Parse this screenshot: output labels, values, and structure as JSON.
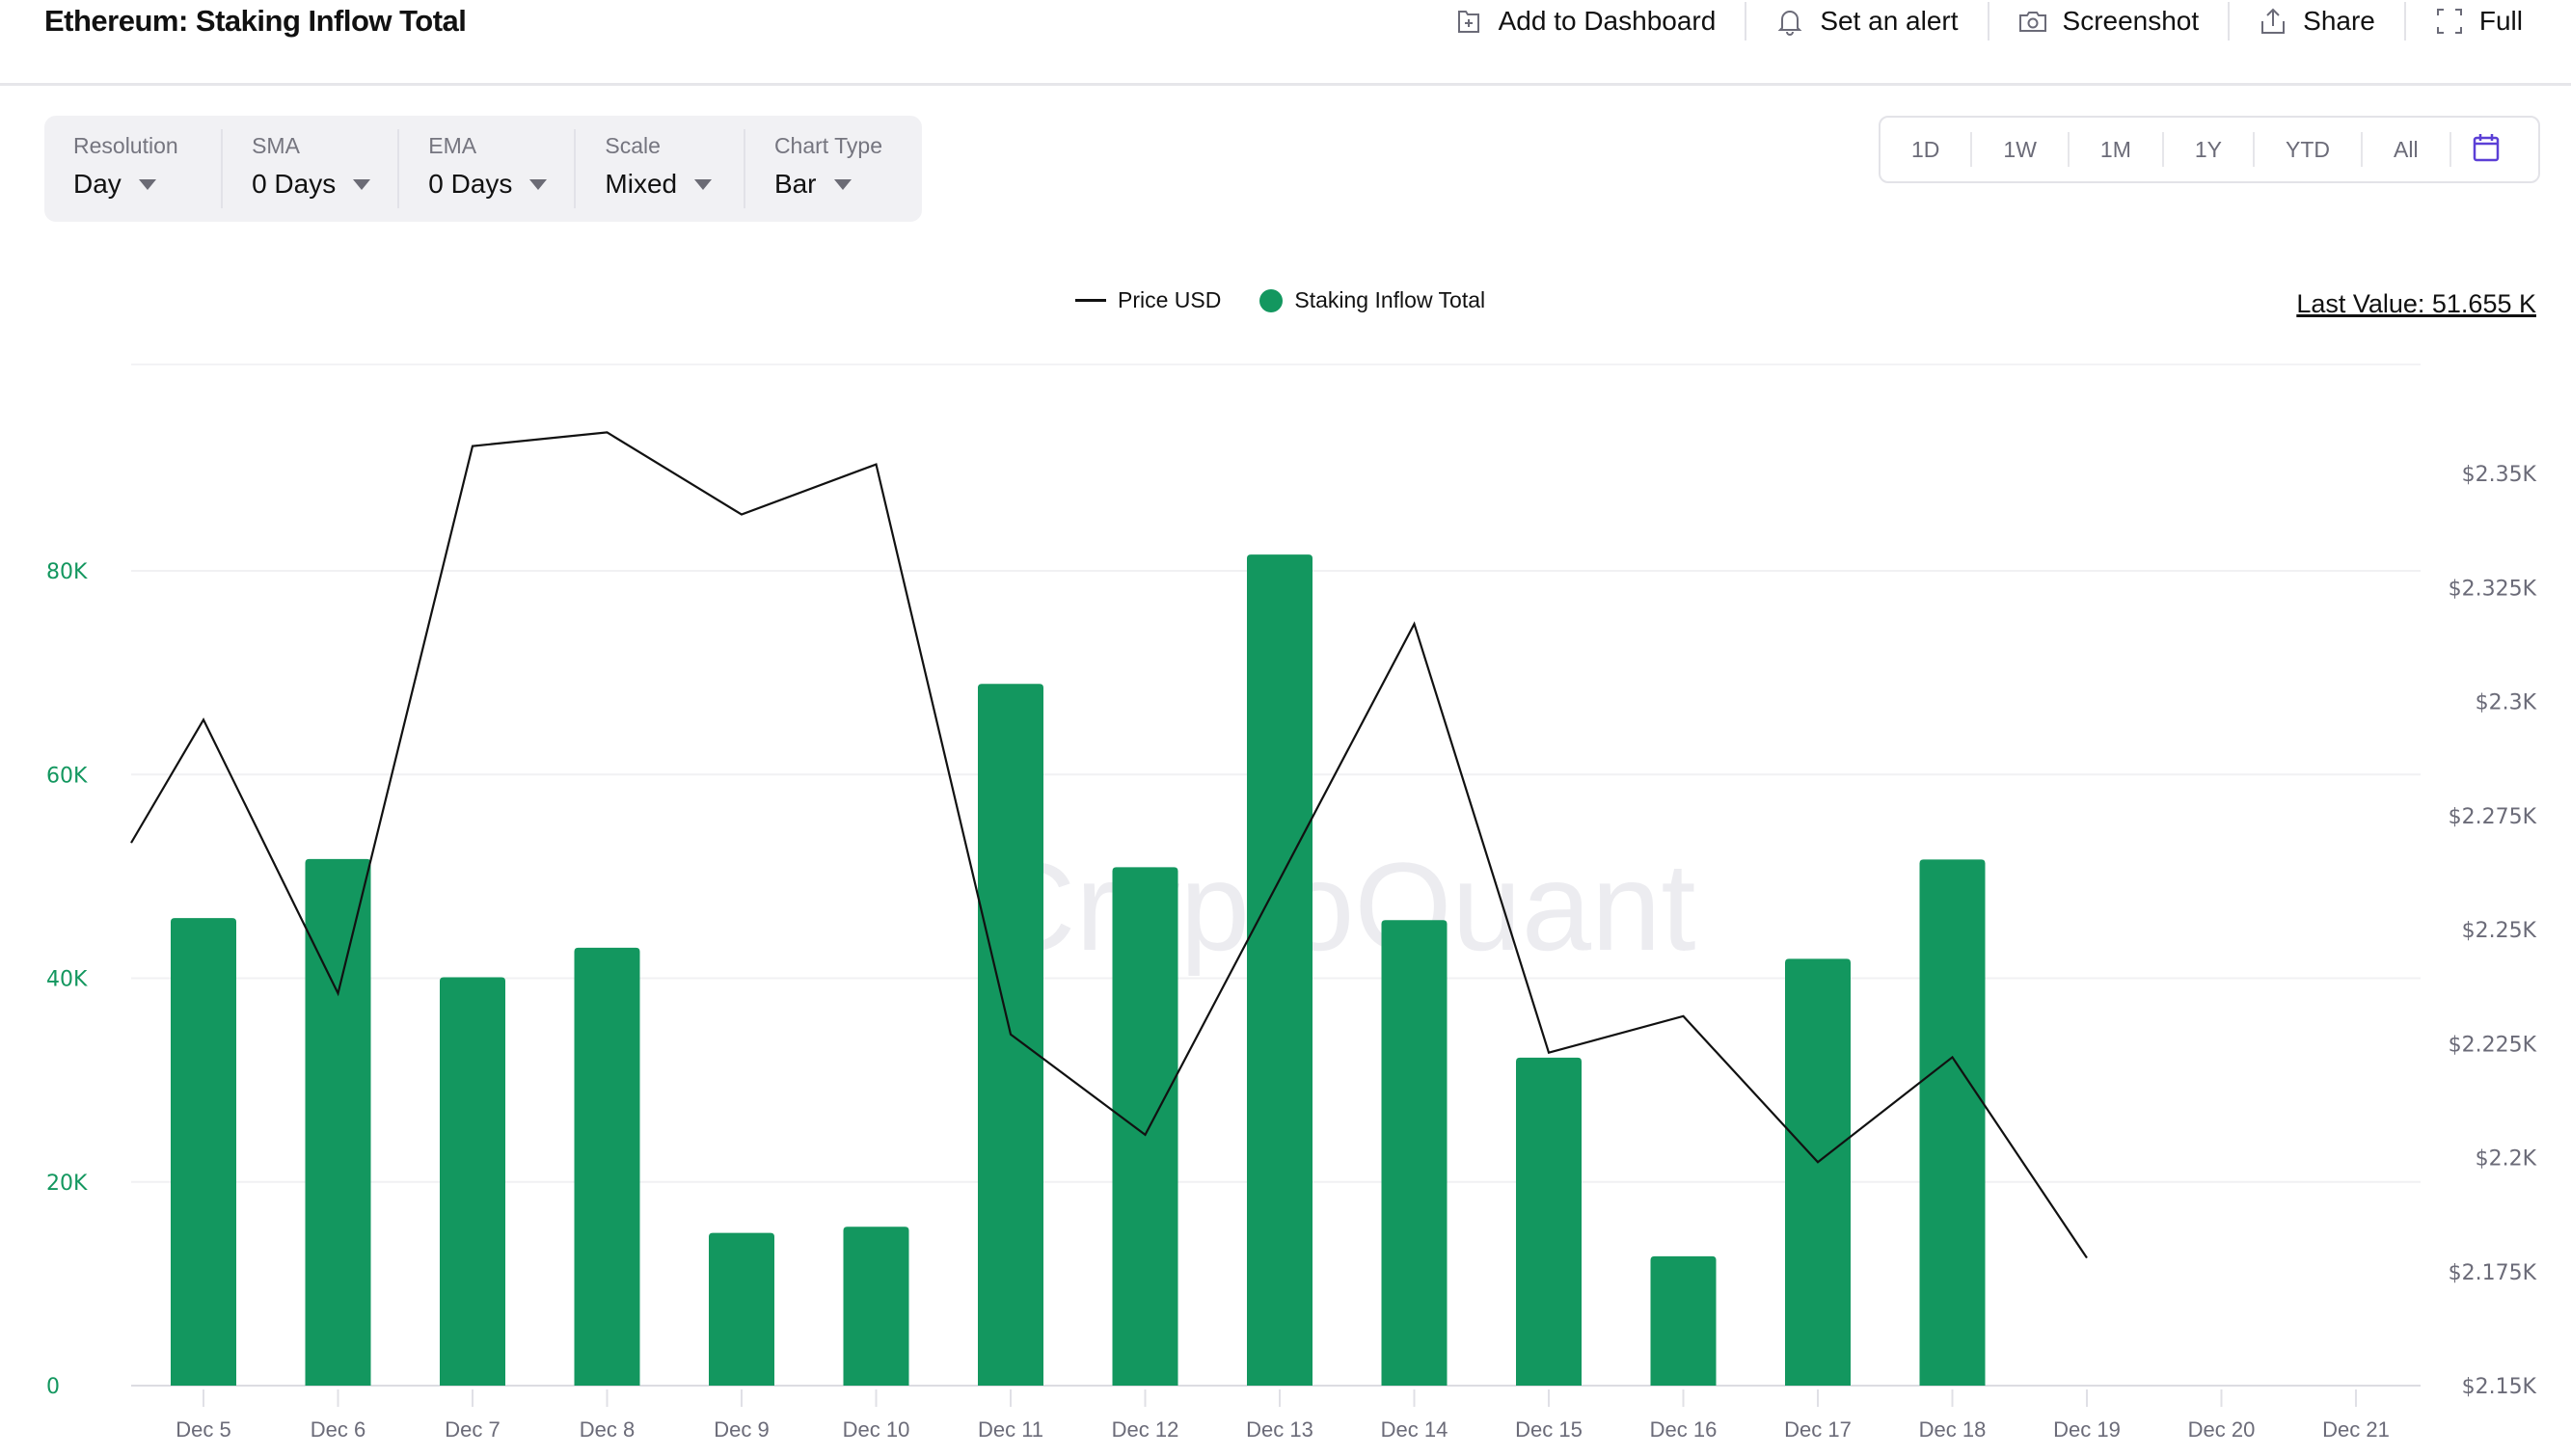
{
  "header": {
    "title": "Ethereum: Staking Inflow Total",
    "actions": [
      {
        "label": "Add to Dashboard",
        "icon": "add-to-dashboard-icon"
      },
      {
        "label": "Set an alert",
        "icon": "bell-icon"
      },
      {
        "label": "Screenshot",
        "icon": "camera-icon"
      },
      {
        "label": "Share",
        "icon": "share-icon"
      },
      {
        "label": "Full",
        "icon": "fullscreen-icon"
      }
    ]
  },
  "controls": [
    {
      "label": "Resolution",
      "value": "Day"
    },
    {
      "label": "SMA",
      "value": "0 Days"
    },
    {
      "label": "EMA",
      "value": "0 Days"
    },
    {
      "label": "Scale",
      "value": "Mixed"
    },
    {
      "label": "Chart Type",
      "value": "Bar"
    }
  ],
  "ranges": [
    "1D",
    "1W",
    "1M",
    "1Y",
    "YTD",
    "All"
  ],
  "last_value": "Last Value: 51.655 K",
  "colors": {
    "bar": "#13975f",
    "line": "#111111",
    "accent": "#5b3fd6"
  },
  "chart_data": {
    "type": "bar",
    "title": "Ethereum: Staking Inflow Total",
    "categories": [
      "Dec 5",
      "Dec 6",
      "Dec 7",
      "Dec 8",
      "Dec 9",
      "Dec 10",
      "Dec 11",
      "Dec 12",
      "Dec 13",
      "Dec 14",
      "Dec 15",
      "Dec 16",
      "Dec 17",
      "Dec 18",
      "Dec 19",
      "Dec 20",
      "Dec 21"
    ],
    "legend": [
      "Price USD",
      "Staking Inflow Total"
    ],
    "legend_position": "top-center",
    "series": [
      {
        "name": "Staking Inflow Total",
        "type": "bar",
        "axis": "left",
        "values": [
          45900,
          51700,
          40100,
          43000,
          15000,
          15600,
          68900,
          50900,
          81600,
          45700,
          32200,
          12700,
          41900,
          51655,
          null,
          null,
          null
        ]
      },
      {
        "name": "Price USD",
        "type": "line",
        "axis": "right",
        "start_value": 2269,
        "values": [
          2296,
          2236,
          2356,
          2359,
          2341,
          2352,
          2227,
          2205,
          2261,
          2317,
          2223,
          2231,
          2199,
          2222,
          2178,
          null,
          null
        ]
      }
    ],
    "left_axis": {
      "ticks": [
        "0",
        "20K",
        "40K",
        "60K",
        "80K"
      ],
      "tick_values": [
        0,
        20000,
        40000,
        60000,
        80000
      ],
      "range": [
        0,
        80000
      ]
    },
    "right_axis": {
      "ticks": [
        "$2.15K",
        "$2.175K",
        "$2.2K",
        "$2.225K",
        "$2.25K",
        "$2.275K",
        "$2.3K",
        "$2.325K",
        "$2.35K"
      ],
      "tick_values": [
        2150,
        2175,
        2200,
        2225,
        2250,
        2275,
        2300,
        2325,
        2350
      ],
      "range": [
        2150,
        2350
      ]
    },
    "watermark": "CryptoQuant",
    "grid": true
  }
}
